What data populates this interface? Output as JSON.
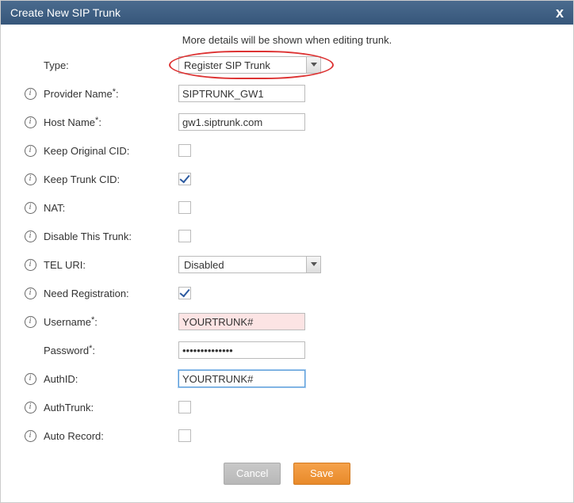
{
  "dialog": {
    "title": "Create New SIP Trunk",
    "hint": "More details will be shown when editing trunk."
  },
  "fields": {
    "type": {
      "label": "Type:",
      "value": "Register SIP Trunk"
    },
    "provider": {
      "label": "Provider Name",
      "value": "SIPTRUNK_GW1"
    },
    "host": {
      "label": "Host Name",
      "value": "gw1.siptrunk.com"
    },
    "keeporigcid": {
      "label": "Keep Original CID:",
      "checked": false
    },
    "keeptrunkcid": {
      "label": "Keep Trunk CID:",
      "checked": true
    },
    "nat": {
      "label": "NAT:",
      "checked": false
    },
    "disable": {
      "label": "Disable This Trunk:",
      "checked": false
    },
    "teluri": {
      "label": "TEL URI:",
      "value": "Disabled"
    },
    "needreg": {
      "label": "Need Registration:",
      "checked": true
    },
    "username": {
      "label": "Username",
      "value": "YOURTRUNK#"
    },
    "password": {
      "label": "Password",
      "value": "••••••••••••••"
    },
    "authid": {
      "label": "AuthID:",
      "value": "YOURTRUNK#"
    },
    "authtrunk": {
      "label": "AuthTrunk:",
      "checked": false
    },
    "autorecord": {
      "label": "Auto Record:",
      "checked": false
    }
  },
  "buttons": {
    "cancel": "Cancel",
    "save": "Save"
  },
  "glyphs": {
    "close": "x",
    "info": "i",
    "required": "*",
    "colon": ":"
  }
}
